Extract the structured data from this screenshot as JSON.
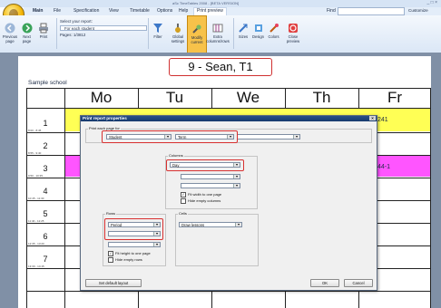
{
  "window": {
    "title": "aSc TimeTables 2008 - [BETA VERSION]",
    "controls": "_ □ ×"
  },
  "menu": {
    "items": [
      "Main",
      "File",
      "Specification",
      "View",
      "Timetable",
      "Options",
      "Help",
      "Print preview"
    ],
    "find_label": "Find",
    "customize": "Customize"
  },
  "ribbon": {
    "previous_page": "Previous page",
    "next_page": "Next page",
    "print": "Print",
    "select_report": "Select your report:",
    "report_value": "For each student",
    "pages": "Pages: 1/3812",
    "filter": "Filter",
    "global_settings": "Global settings",
    "modify_current": "Modify current",
    "extra": "Extra columns/rows",
    "sizes": "Sizes",
    "design": "Design",
    "colors": "Colors",
    "close_preview": "Close preview"
  },
  "timetable": {
    "school": "Sample school",
    "title": "9 - Sean, T1",
    "days": [
      "Mo",
      "Tu",
      "We",
      "Th",
      "Fr"
    ],
    "periods": [
      {
        "num": "1",
        "time": "8:00 - 8:45"
      },
      {
        "num": "2",
        "time": "8:55 - 9:40"
      },
      {
        "num": "3",
        "time": "9:50 - 10:35"
      },
      {
        "num": "4",
        "time": "10:45 - 11:30"
      },
      {
        "num": "5",
        "time": "11:40 - 12:25"
      },
      {
        "num": "6",
        "time": "12:35 - 13:20"
      },
      {
        "num": "7",
        "time": "13:30 - 14:15"
      }
    ],
    "fr_cell_1": "241",
    "fr_cell_3": "44-1"
  },
  "dialog": {
    "title": "Print report properties",
    "close": "×",
    "print_each_page_for": "Print each page for",
    "entity_value": "Student",
    "entity_option": "Term",
    "columns_label": "Columns",
    "columns_value": "Day",
    "fit_width": "Fit width to one page",
    "hide_empty_columns": "Hide empty columns",
    "rows_label": "Rows",
    "rows_value": "Period",
    "fit_height": "Fit height to one page",
    "hide_empty_rows": "Hide empty rows",
    "cells_label": "Cells",
    "cells_value": "Draw lessons",
    "default_layout": "Set default layout",
    "ok": "OK",
    "cancel": "Cancel"
  },
  "colors": {
    "accent": "#d83030",
    "cell_yellow": "#ffff55",
    "cell_magenta": "#ff55ff"
  }
}
